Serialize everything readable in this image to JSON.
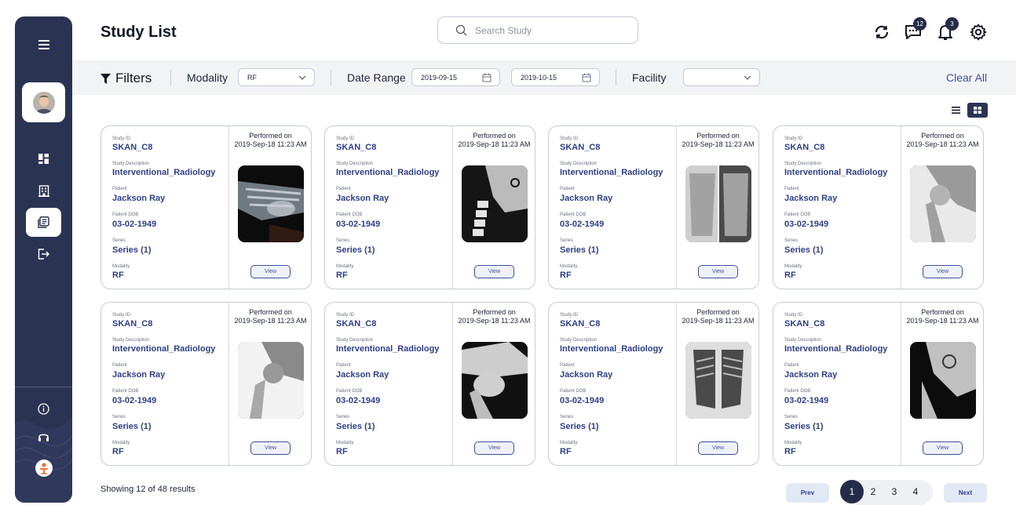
{
  "header": {
    "title": "Study List",
    "search_placeholder": "Search Study",
    "messages_count": "12",
    "notifications_count": "3"
  },
  "filters": {
    "label": "Filters",
    "modality_label": "Modality",
    "modality_value": "RF",
    "date_range_label": "Date Range",
    "date_from": "2019-09-15",
    "date_to": "2019-10-15",
    "facility_label": "Facility",
    "facility_value": "",
    "clear_all": "Clear All"
  },
  "card_labels": {
    "study_id": "Study ID",
    "study_description": "Study Description",
    "patient": "Patient",
    "patient_dob": "Patient DOB",
    "series": "Series",
    "modality": "Modality",
    "performed_on": "Performed on",
    "view": "View"
  },
  "studies": [
    {
      "study_id": "SKAN_C8",
      "description": "Interventional_Radiology",
      "patient": "Jackson Ray",
      "dob": "03-02-1949",
      "series": "Series (1)",
      "modality": "RF",
      "performed": "2019-Sep-18 11:23 AM",
      "image": "hand-xray"
    },
    {
      "study_id": "SKAN_C8",
      "description": "Interventional_Radiology",
      "patient": "Jackson Ray",
      "dob": "03-02-1949",
      "series": "Series (1)",
      "modality": "RF",
      "performed": "2019-Sep-18 11:23 AM",
      "image": "cervical-spine-xray"
    },
    {
      "study_id": "SKAN_C8",
      "description": "Interventional_Radiology",
      "patient": "Jackson Ray",
      "dob": "03-02-1949",
      "series": "Series (1)",
      "modality": "RF",
      "performed": "2019-Sep-18 11:23 AM",
      "image": "chest-xray-split"
    },
    {
      "study_id": "SKAN_C8",
      "description": "Interventional_Radiology",
      "patient": "Jackson Ray",
      "dob": "03-02-1949",
      "series": "Series (1)",
      "modality": "RF",
      "performed": "2019-Sep-18 11:23 AM",
      "image": "hip-xray"
    },
    {
      "study_id": "SKAN_C8",
      "description": "Interventional_Radiology",
      "patient": "Jackson Ray",
      "dob": "03-02-1949",
      "series": "Series (1)",
      "modality": "RF",
      "performed": "2019-Sep-18 11:23 AM",
      "image": "hip-xray-light"
    },
    {
      "study_id": "SKAN_C8",
      "description": "Interventional_Radiology",
      "patient": "Jackson Ray",
      "dob": "03-02-1949",
      "series": "Series (1)",
      "modality": "RF",
      "performed": "2019-Sep-18 11:23 AM",
      "image": "shoulder-xray"
    },
    {
      "study_id": "SKAN_C8",
      "description": "Interventional_Radiology",
      "patient": "Jackson Ray",
      "dob": "03-02-1949",
      "series": "Series (1)",
      "modality": "RF",
      "performed": "2019-Sep-18 11:23 AM",
      "image": "chest-xray"
    },
    {
      "study_id": "SKAN_C8",
      "description": "Interventional_Radiology",
      "patient": "Jackson Ray",
      "dob": "03-02-1949",
      "series": "Series (1)",
      "modality": "RF",
      "performed": "2019-Sep-18 11:23 AM",
      "image": "skull-xray"
    }
  ],
  "pagination": {
    "results_text": "Showing 12 of 48 results",
    "prev": "Prev",
    "next": "Next",
    "pages": [
      "1",
      "2",
      "3",
      "4"
    ],
    "current": "1"
  },
  "colors": {
    "sidebar": "#2b3353",
    "accent": "#2d3f86",
    "badge": "#252c47"
  }
}
